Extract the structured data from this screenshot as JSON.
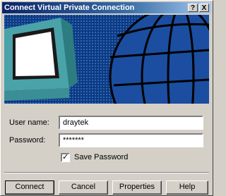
{
  "window": {
    "title": "Connect Virtual Private Connection",
    "help_glyph": "?",
    "close_glyph": "X"
  },
  "form": {
    "username_label": "User name:",
    "username_value": "draytek",
    "password_label": "Password:",
    "password_value": "*******",
    "save_password_label": "Save Password",
    "save_password_checked": true,
    "checkmark": "✓"
  },
  "buttons": {
    "connect": "Connect",
    "cancel": "Cancel",
    "properties": "Properties",
    "help": "Help"
  },
  "colors": {
    "banner_dark": "#0f3e86",
    "monitor_teal": "#4aa3a9"
  }
}
